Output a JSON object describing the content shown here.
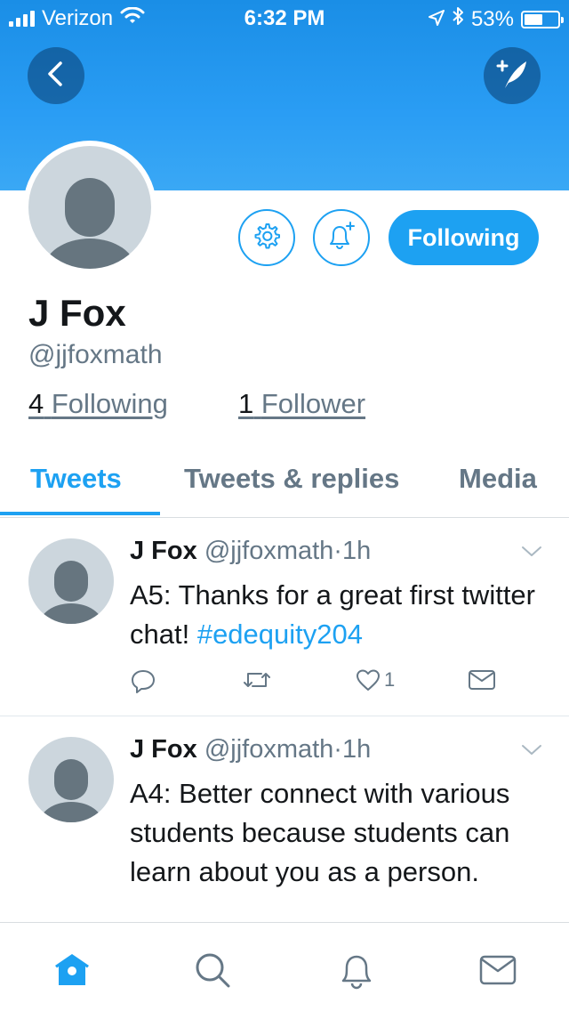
{
  "status_bar": {
    "carrier": "Verizon",
    "time": "6:32 PM",
    "battery": "53%"
  },
  "profile": {
    "name": "J Fox",
    "handle": "@jjfoxmath",
    "following_count": "4",
    "following_label": "Following",
    "followers_count": "1",
    "followers_label": "Follower",
    "follow_button_label": "Following"
  },
  "tabs": [
    {
      "label": "Tweets",
      "active": true
    },
    {
      "label": "Tweets & replies",
      "active": false
    },
    {
      "label": "Media",
      "active": false
    }
  ],
  "tweets": [
    {
      "name": "J Fox",
      "handle": "@jjfoxmath",
      "separator": "·",
      "time": "1h",
      "text": "A5: Thanks for a great first twitter chat! ",
      "hashtag": "#edequity204",
      "like_count": "1"
    },
    {
      "name": "J Fox",
      "handle": "@jjfoxmath",
      "separator": "·",
      "time": "1h",
      "text": "A4: Better connect with various students because students can learn about you as a person."
    }
  ],
  "colors": {
    "accent": "#1da1f2",
    "banner": "#2a9df4",
    "muted_text": "#657786"
  },
  "icons": {
    "back": "chevron-left-icon",
    "compose": "compose-feather-icon",
    "settings": "gear-icon",
    "notifications": "bell-plus-icon",
    "nav": [
      "home-icon",
      "search-icon",
      "bell-icon",
      "envelope-icon"
    ]
  }
}
